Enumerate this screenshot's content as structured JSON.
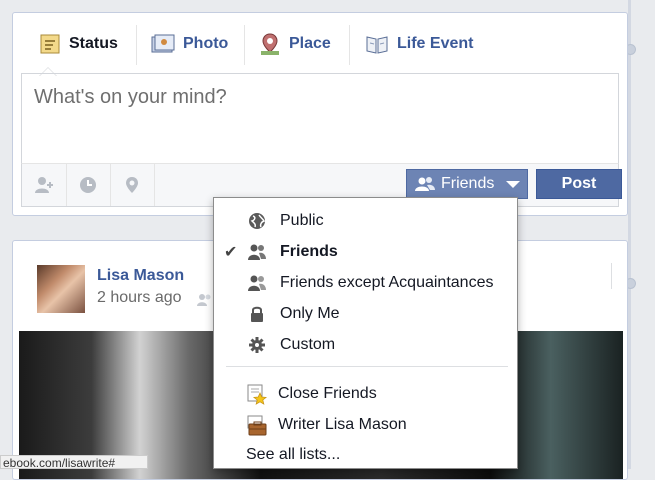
{
  "composer": {
    "tabs": [
      {
        "label": "Status",
        "icon": "status-icon"
      },
      {
        "label": "Photo",
        "icon": "photo-icon"
      },
      {
        "label": "Place",
        "icon": "place-icon"
      },
      {
        "label": "Life Event",
        "icon": "life-event-icon"
      }
    ],
    "placeholder": "What's on your mind?",
    "tools": [
      "tag-friends-icon",
      "clock-icon",
      "location-pin-icon"
    ],
    "audience_label": "Friends",
    "post_label": "Post"
  },
  "post": {
    "author": "Lisa Mason",
    "time": "2 hours ago"
  },
  "audience_menu": {
    "items": [
      {
        "label": "Public",
        "icon": "globe-icon",
        "selected": false
      },
      {
        "label": "Friends",
        "icon": "friends-icon",
        "selected": true
      },
      {
        "label": "Friends except Acquaintances",
        "icon": "friends-except-icon",
        "selected": false
      },
      {
        "label": "Only Me",
        "icon": "lock-icon",
        "selected": false
      },
      {
        "label": "Custom",
        "icon": "gear-icon",
        "selected": false
      }
    ],
    "lists": [
      {
        "label": "Close Friends",
        "icon": "star-list-icon"
      },
      {
        "label": "Writer Lisa Mason",
        "icon": "briefcase-icon"
      }
    ],
    "see_all": "See all lists...",
    "check_glyph": "✔"
  },
  "status_bar": "ebook.com/lisawrite#",
  "colors": {
    "link": "#3b5998",
    "button": "#4e69a2",
    "audience_button": "#6d84b4"
  }
}
